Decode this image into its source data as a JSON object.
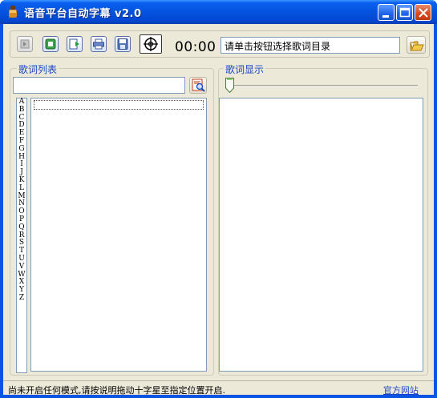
{
  "window": {
    "title": "语音平台自动字幕 v2.0",
    "minimize_label": "minimize-icon",
    "maximize_label": "maximize-icon",
    "close_label": "close-icon"
  },
  "toolbar": {
    "time": "00:00",
    "dir_value": "请单击按钮选择歌词目录",
    "icons": [
      "play-icon",
      "stop-icon",
      "export-icon",
      "print-icon",
      "save-icon",
      "crosshair-icon",
      "folder-open-icon"
    ]
  },
  "lyrics_list": {
    "title": "歌词列表",
    "search_value": "",
    "alphabet": [
      "A",
      "B",
      "C",
      "D",
      "E",
      "F",
      "G",
      "H",
      "I",
      "J",
      "K",
      "L",
      "M",
      "N",
      "O",
      "P",
      "Q",
      "R",
      "S",
      "T",
      "U",
      "V",
      "W",
      "X",
      "Y",
      "Z"
    ],
    "songs": []
  },
  "lyrics_display": {
    "title": "歌词显示",
    "content": "",
    "slider_position": 0
  },
  "status": {
    "message": "尚未开启任何模式,请按说明拖动十字星至指定位置开启.",
    "link": "官方网站"
  },
  "colors": {
    "titlebar": "#0453e0",
    "client_bg": "#ece9d8",
    "group_title": "#1a45c9",
    "link": "#1a45c9"
  }
}
